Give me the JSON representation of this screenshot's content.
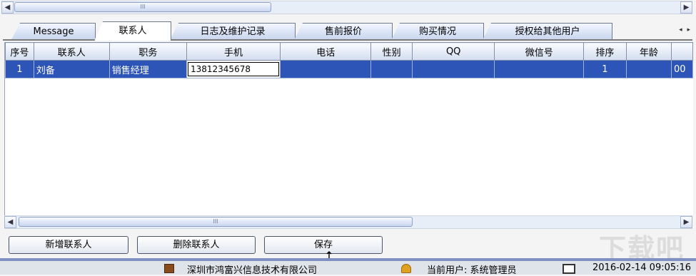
{
  "tabs": [
    {
      "label": "Message",
      "active": false
    },
    {
      "label": "联系人",
      "active": true
    },
    {
      "label": "日志及维护记录",
      "active": false
    },
    {
      "label": "售前报价",
      "active": false
    },
    {
      "label": "购买情况",
      "active": false
    },
    {
      "label": "授权给其他用户",
      "active": false
    }
  ],
  "tab_scroll_glyph": "◂ ▸",
  "scroll_thumb_glyph": "III",
  "table": {
    "columns": [
      "序号",
      "联系人",
      "职务",
      "手机",
      "电话",
      "性别",
      "QQ",
      "微信号",
      "排序",
      "年龄"
    ],
    "rows": [
      {
        "no": "1",
        "name": "刘备",
        "title": "销售经理",
        "mobile": "13812345678",
        "phone": "",
        "gender": "",
        "qq": "",
        "wechat": "",
        "order": "1",
        "age": "",
        "overflow": "00"
      }
    ]
  },
  "buttons": {
    "add": "新增联系人",
    "delete": "删除联系人",
    "save": "保存"
  },
  "status": {
    "company": "深圳市鸿富兴信息技术有限公司",
    "user": "当前用户: 系统管理员",
    "datetime": "2016-02-14 09:05:16"
  },
  "watermark": "下载吧",
  "colors": {
    "selection": "#2d55b8",
    "status_border": "#7f8fc2"
  }
}
